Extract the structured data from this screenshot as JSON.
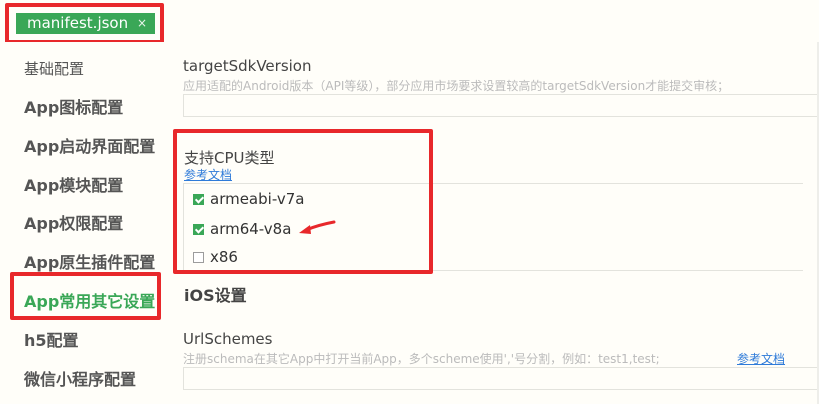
{
  "tab": {
    "label": "manifest.json",
    "close": "×"
  },
  "sidebar": {
    "items": [
      {
        "label": "基础配置"
      },
      {
        "label": "App图标配置"
      },
      {
        "label": "App启动界面配置"
      },
      {
        "label": "App模块配置"
      },
      {
        "label": "App权限配置"
      },
      {
        "label": "App原生插件配置"
      },
      {
        "label": "App常用其它设置"
      },
      {
        "label": "h5配置"
      },
      {
        "label": "微信小程序配置"
      }
    ],
    "active_color": "#3aa757"
  },
  "main": {
    "target_sdk": {
      "label": "targetSdkVersion",
      "description": "应用适配的Android版本（API等级），部分应用市场要求设置较高的targetSdkVersion才能提交审核；",
      "value": ""
    },
    "cpu": {
      "label": "支持CPU类型",
      "doc_link": "参考文档",
      "options": [
        {
          "label": "armeabi-v7a",
          "checked": true
        },
        {
          "label": "arm64-v8a",
          "checked": true
        },
        {
          "label": "x86",
          "checked": false
        }
      ]
    },
    "ios_section": {
      "label": "iOS设置"
    },
    "url_schemes": {
      "label": "UrlSchemes",
      "description": "注册schema在其它App中打开当前App，多个scheme使用','号分割，例如：test1,test;",
      "doc_link": "参考文档",
      "value": ""
    }
  },
  "colors": {
    "accent": "#3aa757",
    "highlight": "#e8282b",
    "link": "#2f7bd9"
  }
}
